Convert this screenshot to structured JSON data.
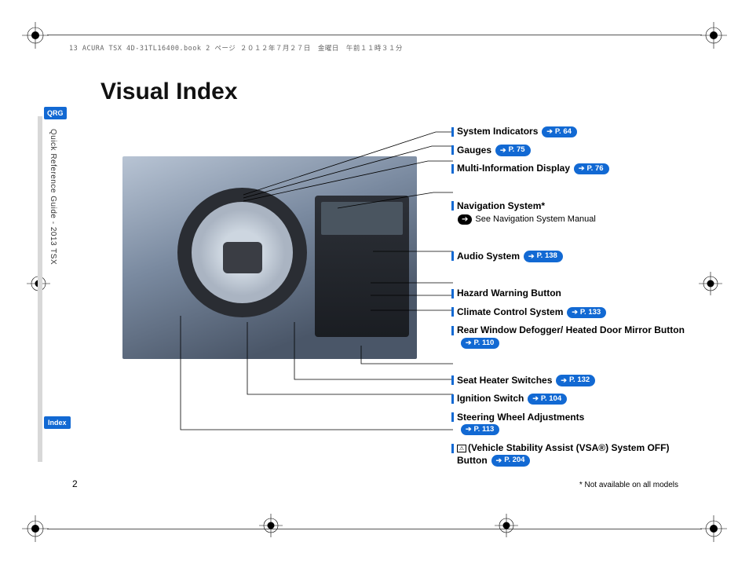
{
  "header": "13 ACURA TSX 4D-31TL16400.book  2 ページ  ２０１２年７月２７日　金曜日　午前１１時３１分",
  "title": "Visual Index",
  "sidebar": {
    "qrg": "QRG",
    "guide": "Quick Reference Guide - 2013 TSX",
    "index": "Index"
  },
  "callouts": [
    {
      "label": "System Indicators",
      "page": "P. 64",
      "gap": ""
    },
    {
      "label": "Gauges",
      "page": "P. 75",
      "gap": ""
    },
    {
      "label": "Multi-Information Display",
      "page": "P. 76",
      "gap": "gap-md"
    },
    {
      "label": "Navigation System*",
      "page": "",
      "subnote": "See Navigation System Manual",
      "gap": "gap-md"
    },
    {
      "label": "Audio System",
      "page": "P. 138",
      "gap": "gap-md"
    },
    {
      "label": "Hazard Warning Button",
      "page": "",
      "gap": ""
    },
    {
      "label": "Climate Control System",
      "page": "P. 133",
      "gap": ""
    },
    {
      "label": "Rear Window Defogger/ Heated Door Mirror Button",
      "page": "P. 110",
      "gap": "gap-md",
      "wrap": true
    },
    {
      "label": "Seat Heater Switches",
      "page": "P. 132",
      "gap": ""
    },
    {
      "label": "Ignition Switch",
      "page": "P. 104",
      "gap": ""
    },
    {
      "label": "Steering Wheel Adjustments",
      "page": "P. 113",
      "gap": "",
      "wrap": true
    },
    {
      "label": "(Vehicle Stability Assist (VSA®) System OFF) Button",
      "page": "P. 204",
      "gap": "",
      "icon": true
    }
  ],
  "pageNumber": "2",
  "footnote": "* Not available on all models"
}
